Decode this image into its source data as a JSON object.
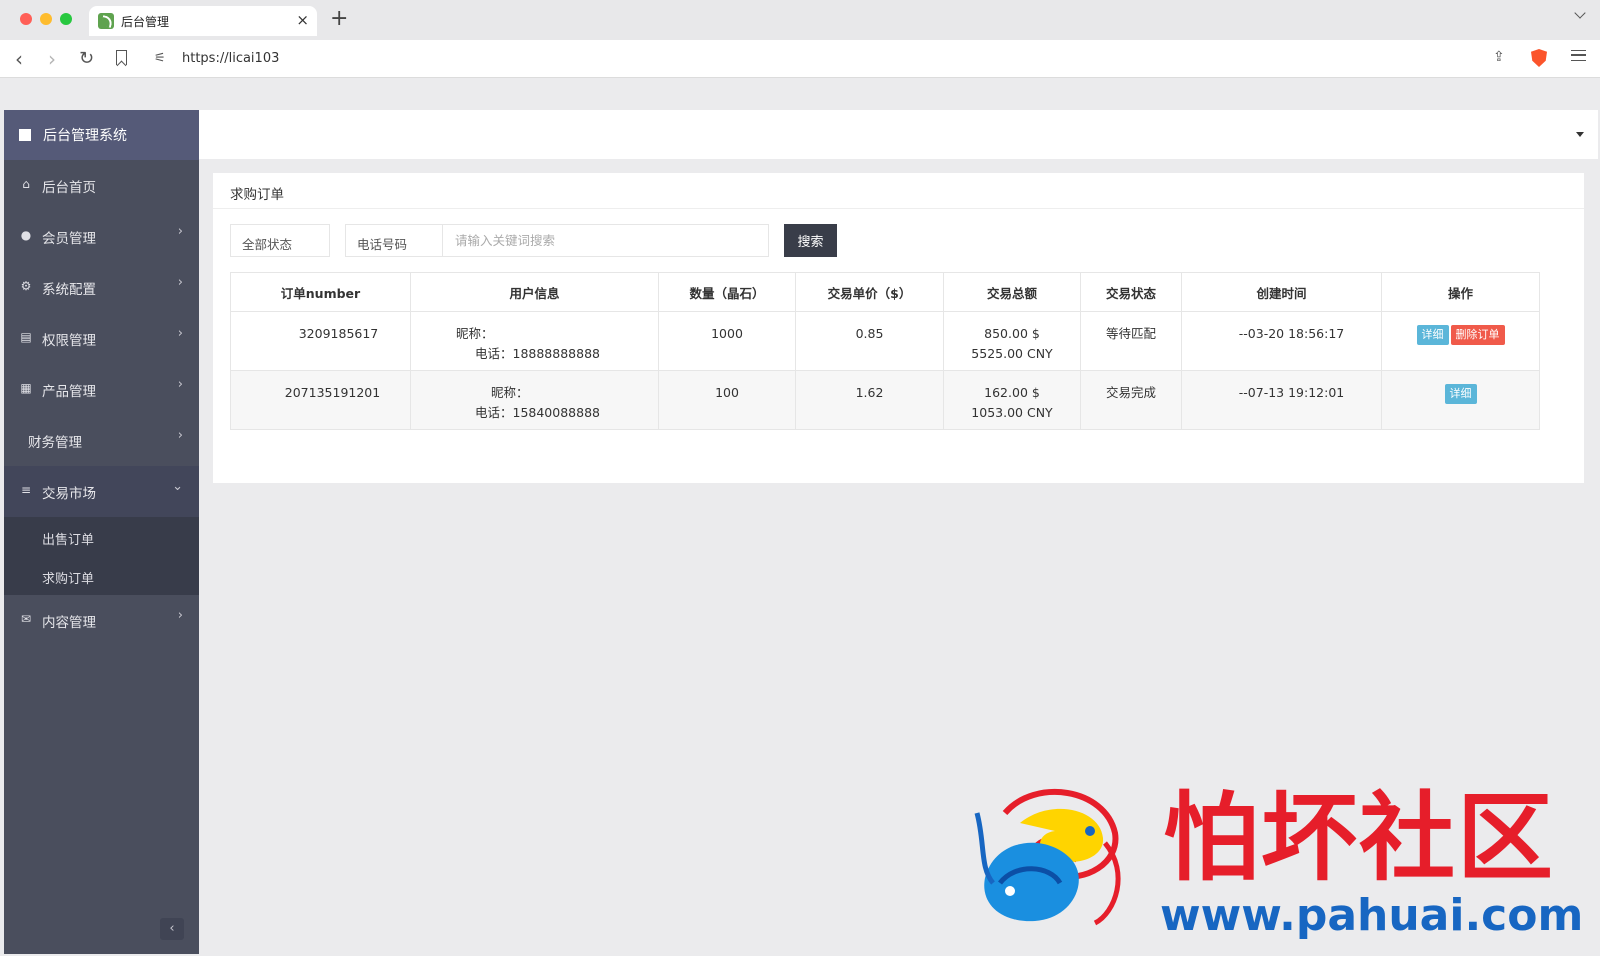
{
  "browser": {
    "tab_title": "后台管理",
    "tab_close": "×",
    "new_tab": "+",
    "url": "https://licai103",
    "back": "‹",
    "forward": "›",
    "reload": "↻",
    "share": "⇪",
    "icons": [
      "favicon-icon",
      "bookmark-icon",
      "site-settings-icon",
      "share-icon",
      "brave-shield-icon",
      "menu-icon"
    ]
  },
  "sidebar": {
    "brand": "后台管理系统",
    "items": [
      {
        "label": "后台首页",
        "icon": "⌂",
        "arrow": ""
      },
      {
        "label": "会员管理",
        "icon": "●",
        "arrow": "›"
      },
      {
        "label": "系统配置",
        "icon": "⚙",
        "arrow": "›"
      },
      {
        "label": "权限管理",
        "icon": "▤",
        "arrow": "›"
      },
      {
        "label": "产品管理",
        "icon": "▦",
        "arrow": "›"
      },
      {
        "label": "财务管理",
        "icon": "",
        "arrow": "›"
      },
      {
        "label": "交易市场",
        "icon": "≡",
        "arrow": "⌄"
      },
      {
        "label": "内容管理",
        "icon": "✉",
        "arrow": "›"
      }
    ],
    "submenu": [
      {
        "label": "出售订单"
      },
      {
        "label": "求购订单"
      }
    ],
    "collapse": "‹"
  },
  "panel": {
    "title": "求购订单",
    "filter": {
      "status": "全部状态",
      "field": "电话号码",
      "placeholder": "请输入关键词搜索",
      "search_button": "搜索"
    },
    "columns": [
      "订单number",
      "用户信息",
      "数量（晶石）",
      "交易单价（$）",
      "交易总额",
      "交易状态",
      "创建时间",
      "操作"
    ],
    "rows": [
      {
        "order": "3209185617",
        "nick": "昵称：",
        "phone": "电话：18888888888",
        "qty": "1000",
        "price": "0.85",
        "total_usd": "850.00 $",
        "total_cny": "5525.00 CNY",
        "status": "等待匹配",
        "created": "--03-20 18:56:17",
        "btn_detail": "详细",
        "btn_delete": "删除订单"
      },
      {
        "order": "207135191201",
        "nick": "昵称：",
        "phone": "电话：15840088888",
        "qty": "100",
        "price": "1.62",
        "total_usd": "162.00 $",
        "total_cny": "1053.00 CNY",
        "status": "交易完成",
        "created": "--07-13 19:12:01",
        "btn_detail": "详细"
      }
    ]
  },
  "watermark": {
    "cn": "怕坏社区",
    "url": "www.pahuai.com"
  },
  "colors": {
    "sidebar": "#4a4e5d",
    "brand_bg": "#555a78",
    "search_button": "#393d49",
    "detail_button": "#5bb6d9",
    "delete_button": "#f05a4a",
    "watermark_red": "#e61e2a",
    "watermark_blue": "#1766c2"
  }
}
